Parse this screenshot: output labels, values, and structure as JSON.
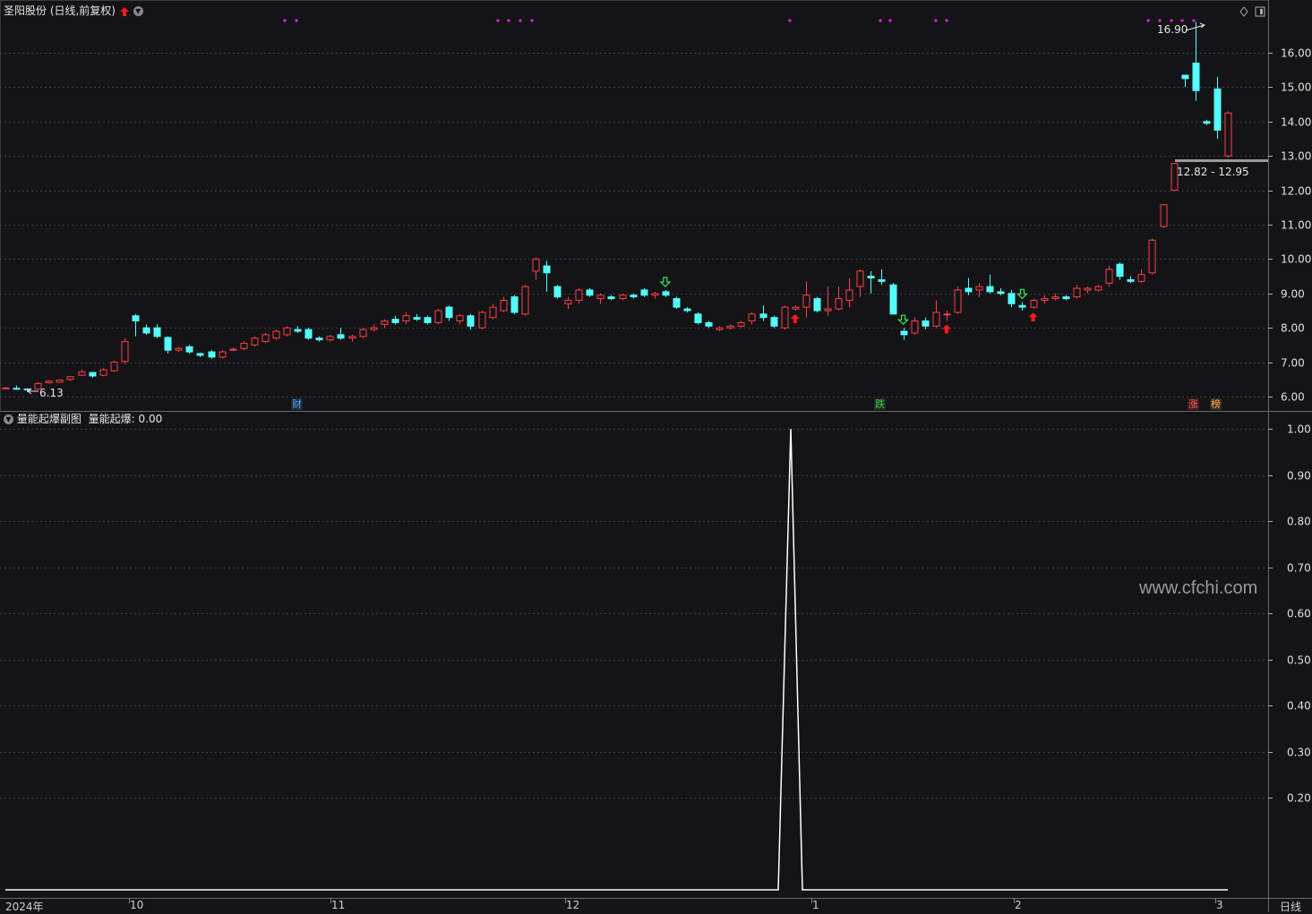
{
  "main_header": {
    "title": "圣阳股份 (日线,前复权)"
  },
  "sub_header": {
    "title": "量能起爆副图",
    "indicator_label": "量能起爆:",
    "indicator_value": "0.00"
  },
  "annotations": {
    "high_label": "16.90",
    "low_label": "6.13",
    "range_label": "12.82 - 12.95"
  },
  "event_tags": [
    {
      "label": "财",
      "color": "#5aa9ff",
      "bg": "#1d2a3a"
    },
    {
      "label": "跌",
      "color": "#39d04c",
      "bg": "#1d2e1f"
    },
    {
      "label": "涨",
      "color": "#ff5c5c",
      "bg": "#3a1d1d"
    },
    {
      "label": "榜",
      "color": "#ffb45a",
      "bg": "#3a2a1d"
    }
  ],
  "timeline": {
    "labels": [
      "2024年",
      "10",
      "11",
      "12",
      "1",
      "2",
      "3"
    ],
    "period": "日线"
  },
  "watermark": "www.cfchi.com",
  "colors": {
    "up": "#ff3d4a",
    "down": "#54ffff",
    "signal_up": "#ff1a1a",
    "signal_down": "#3ce65a",
    "dots": "#e020e0",
    "line": "#ffffff",
    "grid": "#3a3a3e"
  },
  "chart_data": [
    {
      "type": "candlestick",
      "title": "圣阳股份 (日线,前复权)",
      "ylim": [
        5.8,
        17.2
      ],
      "y_ticks": [
        6.0,
        7.0,
        8.0,
        9.0,
        10.0,
        11.0,
        12.0,
        13.0,
        14.0,
        15.0,
        16.0
      ],
      "grid": true,
      "ohlc": [
        [
          6.25,
          6.28,
          6.22,
          6.25
        ],
        [
          6.24,
          6.32,
          6.2,
          6.22
        ],
        [
          6.22,
          6.24,
          6.13,
          6.2
        ],
        [
          6.22,
          6.42,
          6.2,
          6.38
        ],
        [
          6.4,
          6.48,
          6.38,
          6.45
        ],
        [
          6.42,
          6.5,
          6.4,
          6.48
        ],
        [
          6.5,
          6.6,
          6.45,
          6.58
        ],
        [
          6.62,
          6.78,
          6.6,
          6.72
        ],
        [
          6.7,
          6.72,
          6.55,
          6.6
        ],
        [
          6.62,
          6.82,
          6.6,
          6.78
        ],
        [
          6.75,
          7.05,
          6.72,
          7.0
        ],
        [
          7.02,
          7.7,
          6.95,
          7.6
        ],
        [
          8.35,
          8.4,
          7.75,
          8.2
        ],
        [
          8.0,
          8.1,
          7.8,
          7.85
        ],
        [
          8.0,
          8.1,
          7.7,
          7.75
        ],
        [
          7.72,
          7.75,
          7.25,
          7.35
        ],
        [
          7.35,
          7.45,
          7.3,
          7.4
        ],
        [
          7.45,
          7.5,
          7.25,
          7.3
        ],
        [
          7.25,
          7.28,
          7.15,
          7.2
        ],
        [
          7.3,
          7.35,
          7.1,
          7.15
        ],
        [
          7.15,
          7.35,
          7.1,
          7.3
        ],
        [
          7.35,
          7.42,
          7.32,
          7.38
        ],
        [
          7.4,
          7.6,
          7.35,
          7.55
        ],
        [
          7.5,
          7.75,
          7.45,
          7.7
        ],
        [
          7.6,
          7.85,
          7.55,
          7.8
        ],
        [
          7.7,
          7.95,
          7.65,
          7.9
        ],
        [
          7.8,
          8.05,
          7.75,
          8.0
        ],
        [
          7.95,
          8.05,
          7.85,
          7.9
        ],
        [
          7.95,
          8.0,
          7.65,
          7.7
        ],
        [
          7.7,
          7.75,
          7.6,
          7.65
        ],
        [
          7.65,
          7.8,
          7.6,
          7.75
        ],
        [
          7.8,
          8.0,
          7.65,
          7.7
        ],
        [
          7.7,
          7.8,
          7.6,
          7.75
        ],
        [
          7.75,
          8.0,
          7.7,
          7.95
        ],
        [
          7.95,
          8.1,
          7.9,
          8.0
        ],
        [
          8.1,
          8.25,
          8.0,
          8.2
        ],
        [
          8.25,
          8.35,
          8.1,
          8.15
        ],
        [
          8.2,
          8.45,
          8.1,
          8.35
        ],
        [
          8.3,
          8.4,
          8.2,
          8.25
        ],
        [
          8.3,
          8.35,
          8.1,
          8.15
        ],
        [
          8.15,
          8.55,
          8.1,
          8.5
        ],
        [
          8.6,
          8.65,
          8.2,
          8.3
        ],
        [
          8.2,
          8.4,
          8.1,
          8.35
        ],
        [
          8.35,
          8.4,
          7.95,
          8.05
        ],
        [
          8.0,
          8.5,
          7.95,
          8.45
        ],
        [
          8.3,
          8.7,
          8.25,
          8.6
        ],
        [
          8.5,
          8.9,
          8.45,
          8.8
        ],
        [
          8.9,
          8.95,
          8.4,
          8.45
        ],
        [
          8.4,
          9.25,
          8.35,
          9.2
        ],
        [
          9.65,
          10.05,
          9.4,
          10.0
        ],
        [
          9.8,
          9.95,
          9.05,
          9.6
        ],
        [
          9.2,
          9.25,
          8.85,
          8.9
        ],
        [
          8.7,
          8.9,
          8.55,
          8.8
        ],
        [
          8.8,
          9.15,
          8.7,
          9.1
        ],
        [
          9.1,
          9.15,
          8.9,
          8.95
        ],
        [
          8.85,
          9.0,
          8.7,
          8.95
        ],
        [
          8.9,
          8.95,
          8.8,
          8.85
        ],
        [
          8.85,
          9.0,
          8.8,
          8.95
        ],
        [
          8.95,
          9.0,
          8.85,
          8.9
        ],
        [
          9.1,
          9.15,
          8.9,
          8.95
        ],
        [
          8.95,
          9.05,
          8.85,
          9.0
        ],
        [
          9.05,
          9.1,
          8.9,
          8.95
        ],
        [
          8.85,
          8.9,
          8.55,
          8.6
        ],
        [
          8.55,
          8.6,
          8.45,
          8.5
        ],
        [
          8.4,
          8.45,
          8.1,
          8.15
        ],
        [
          8.15,
          8.2,
          8.0,
          8.05
        ],
        [
          7.95,
          8.05,
          7.9,
          8.0
        ],
        [
          8.0,
          8.1,
          7.95,
          8.05
        ],
        [
          8.05,
          8.2,
          8.0,
          8.15
        ],
        [
          8.2,
          8.45,
          8.1,
          8.4
        ],
        [
          8.4,
          8.65,
          8.2,
          8.3
        ],
        [
          8.3,
          8.35,
          8.0,
          8.05
        ],
        [
          8.0,
          8.65,
          7.95,
          8.6
        ],
        [
          8.55,
          8.65,
          8.5,
          8.6
        ],
        [
          8.6,
          9.35,
          8.3,
          8.95
        ],
        [
          8.85,
          8.9,
          8.45,
          8.5
        ],
        [
          8.5,
          9.2,
          8.35,
          8.55
        ],
        [
          8.55,
          9.2,
          8.5,
          8.85
        ],
        [
          8.8,
          9.45,
          8.6,
          9.1
        ],
        [
          9.2,
          9.7,
          8.9,
          9.65
        ],
        [
          9.5,
          9.65,
          9.0,
          9.45
        ],
        [
          9.4,
          9.7,
          9.25,
          9.35
        ],
        [
          9.25,
          9.3,
          8.4,
          8.4
        ],
        [
          7.9,
          8.0,
          7.65,
          7.8
        ],
        [
          7.85,
          8.3,
          7.8,
          8.2
        ],
        [
          8.2,
          8.3,
          7.95,
          8.05
        ],
        [
          8.05,
          8.8,
          8.0,
          8.45
        ],
        [
          8.4,
          8.5,
          8.2,
          8.4
        ],
        [
          8.45,
          9.2,
          8.4,
          9.1
        ],
        [
          9.15,
          9.45,
          8.95,
          9.05
        ],
        [
          9.1,
          9.3,
          8.9,
          9.2
        ],
        [
          9.2,
          9.55,
          9.0,
          9.05
        ],
        [
          9.05,
          9.15,
          8.95,
          9.0
        ],
        [
          9.0,
          9.1,
          8.6,
          8.7
        ],
        [
          8.65,
          8.75,
          8.5,
          8.6
        ],
        [
          8.6,
          8.85,
          8.55,
          8.8
        ],
        [
          8.8,
          8.95,
          8.7,
          8.85
        ],
        [
          8.85,
          9.0,
          8.8,
          8.9
        ],
        [
          8.9,
          8.95,
          8.8,
          8.85
        ],
        [
          8.9,
          9.25,
          8.85,
          9.15
        ],
        [
          9.1,
          9.2,
          9.0,
          9.15
        ],
        [
          9.1,
          9.25,
          9.05,
          9.2
        ],
        [
          9.3,
          9.8,
          9.2,
          9.7
        ],
        [
          9.85,
          9.9,
          9.4,
          9.5
        ],
        [
          9.4,
          9.5,
          9.3,
          9.35
        ],
        [
          9.35,
          9.7,
          9.3,
          9.55
        ],
        [
          9.6,
          10.6,
          9.55,
          10.55
        ],
        [
          10.95,
          11.6,
          10.9,
          11.58
        ],
        [
          12.0,
          12.8,
          11.98,
          12.78
        ],
        [
          15.35,
          15.35,
          15.0,
          15.25
        ],
        [
          15.7,
          16.9,
          14.6,
          14.9
        ],
        [
          14.0,
          14.05,
          13.9,
          13.95
        ],
        [
          14.95,
          15.3,
          13.5,
          13.75
        ],
        [
          13.0,
          14.3,
          12.95,
          14.25
        ]
      ],
      "annotations": {
        "high": 16.9,
        "low": 6.13,
        "range_low": 12.82,
        "range_high": 12.95
      }
    },
    {
      "type": "line",
      "title": "量能起爆副图",
      "series": [
        {
          "name": "量能起爆",
          "spike_value": 1.0,
          "base_value": 0.0
        }
      ],
      "ylim": [
        0.0,
        1.02
      ],
      "y_ticks": [
        0.2,
        0.3,
        0.4,
        0.5,
        0.6,
        0.7,
        0.8,
        0.9,
        1.0
      ],
      "grid": true
    }
  ]
}
